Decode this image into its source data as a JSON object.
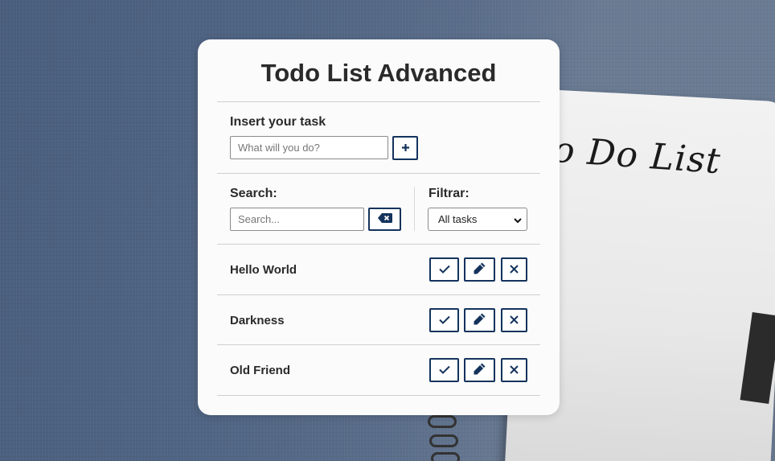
{
  "app": {
    "title": "Todo List Advanced"
  },
  "background": {
    "notebook_text": "o Do List"
  },
  "insert": {
    "label": "Insert your task",
    "placeholder": "What will you do?",
    "value": "",
    "add_icon": "plus-icon"
  },
  "search": {
    "label": "Search:",
    "placeholder": "Search...",
    "value": "",
    "clear_icon": "backspace-icon"
  },
  "filter": {
    "label": "Filtrar:",
    "selected": "All tasks"
  },
  "tasks": [
    {
      "name": "Hello World"
    },
    {
      "name": "Darkness"
    },
    {
      "name": "Old Friend"
    }
  ],
  "task_actions": {
    "done_icon": "check-icon",
    "edit_icon": "pencil-icon",
    "delete_icon": "close-icon"
  },
  "colors": {
    "accent": "#14335c",
    "card_bg": "#fbfbfb"
  }
}
